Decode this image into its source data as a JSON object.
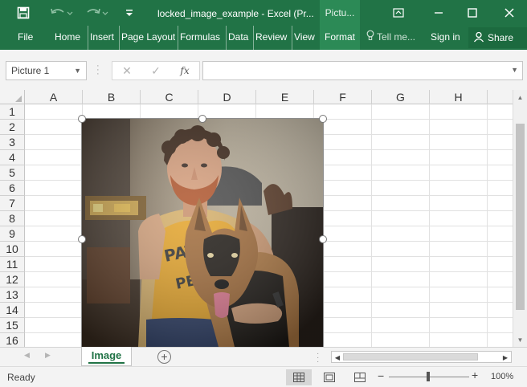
{
  "window": {
    "title": "locked_image_example - Excel (Pr...",
    "context_tab": "Pictu...",
    "icons": [
      "save-icon",
      "undo-icon",
      "redo-icon",
      "customize-qat-icon",
      "ribbon-display-icon",
      "minimize-icon",
      "maximize-icon",
      "close-icon"
    ]
  },
  "ribbon": {
    "tabs": [
      "File",
      "Home",
      "Insert",
      "Page Layout",
      "Formulas",
      "Data",
      "Review",
      "View",
      "Format"
    ],
    "active_tab": "Format",
    "tell_me": "Tell me...",
    "sign_in": "Sign in",
    "share": "Share"
  },
  "formula_bar": {
    "name_box": "Picture 1",
    "fx": "fx",
    "value": ""
  },
  "sheet": {
    "columns": [
      "A",
      "B",
      "C",
      "D",
      "E",
      "F",
      "G",
      "H"
    ],
    "rows": [
      "1",
      "2",
      "3",
      "4",
      "5",
      "6",
      "7",
      "8",
      "9",
      "10",
      "11",
      "12",
      "13",
      "14",
      "15",
      "16"
    ],
    "selected_object": "Picture 1"
  },
  "tabs": {
    "sheets": [
      "Image"
    ],
    "active": "Image"
  },
  "status": {
    "text": "Ready",
    "zoom": "100%",
    "zoom_level": 1.0
  },
  "colors": {
    "accent": "#217346",
    "context_tab": "#2c8a56",
    "chrome_bg": "#f3f3f3"
  }
}
